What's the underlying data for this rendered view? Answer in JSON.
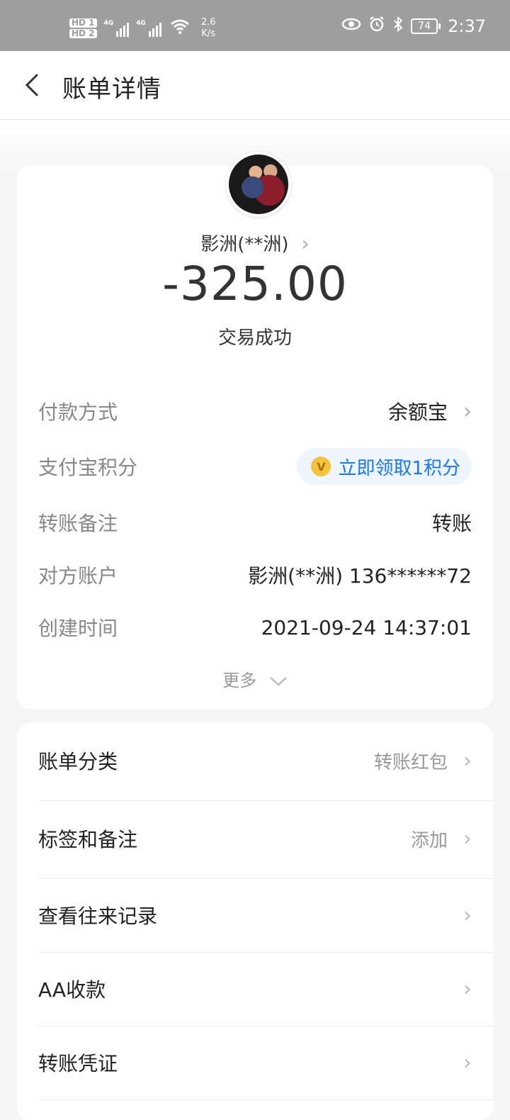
{
  "status_bar": {
    "hd1": "HD 1",
    "hd2": "HD 2",
    "net1": "4G",
    "net2": "4G",
    "speed_value": "2.6",
    "speed_unit": "K/s",
    "battery": "74",
    "time": "2:37"
  },
  "header": {
    "title": "账单详情"
  },
  "transaction": {
    "payee": "影洲(**洲)",
    "amount": "-325.00",
    "status": "交易成功"
  },
  "details": [
    {
      "label": "付款方式",
      "value": "余额宝"
    },
    {
      "label": "支付宝积分",
      "value": "立即领取1积分"
    },
    {
      "label": "转账备注",
      "value": "转账"
    },
    {
      "label": "对方账户",
      "value": "影洲(**洲) 136******72"
    },
    {
      "label": "创建时间",
      "value": "2021-09-24 14:37:01"
    }
  ],
  "more_label": "更多",
  "menu": [
    {
      "label": "账单分类",
      "value": "转账红包"
    },
    {
      "label": "标签和备注",
      "value": "添加"
    },
    {
      "label": "查看往来记录",
      "value": ""
    },
    {
      "label": "AA收款",
      "value": ""
    },
    {
      "label": "转账凭证",
      "value": ""
    }
  ],
  "colors": {
    "accent": "#1677ff",
    "points_bg": "#eef5fd",
    "coin": "#f5c33b"
  }
}
